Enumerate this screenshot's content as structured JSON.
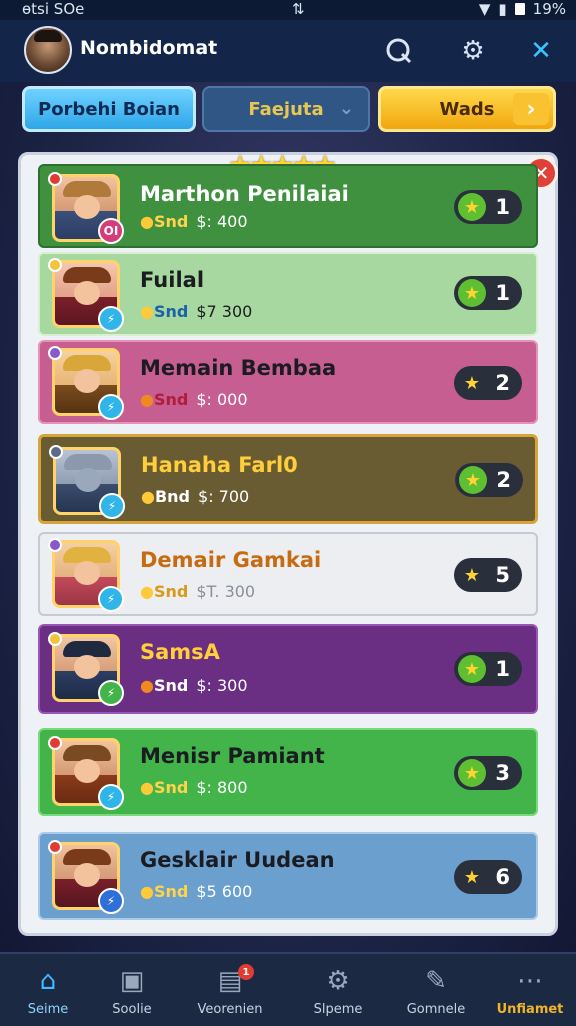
{
  "status_bar": {
    "carrier": "ɵtsi SOe",
    "center_icon": "sync-icon",
    "battery": "19%"
  },
  "header": {
    "username": "Nombidomat"
  },
  "tabs": [
    {
      "label": "Porbehi Boian"
    },
    {
      "label": "Faejuta"
    },
    {
      "label": "Wads"
    }
  ],
  "rows": [
    {
      "name": "Marthon Penilaiai",
      "label": "Snd",
      "price": "$: 400",
      "rank": "1",
      "badge": "OI"
    },
    {
      "name": "Fuilal",
      "label": "Snd",
      "price": "$7 300",
      "rank": "1",
      "badge": ""
    },
    {
      "name": "Memain Bembaa",
      "label": "Snd",
      "price": "$: 000",
      "rank": "2",
      "badge": ""
    },
    {
      "name": "Hanaha Farl0",
      "label": "Bnd",
      "price": "$: 700",
      "rank": "2",
      "badge": ""
    },
    {
      "name": "Demair Gamkai",
      "label": "Snd",
      "price": "$T. 300",
      "rank": "5",
      "badge": ""
    },
    {
      "name": "SamsA",
      "label": "Snd",
      "price": "$: 300",
      "rank": "1",
      "badge": ""
    },
    {
      "name": "Menisr Pamiant",
      "label": "Snd",
      "price": "$: 800",
      "rank": "3",
      "badge": ""
    },
    {
      "name": "Gesklair Uudean",
      "label": "Snd",
      "price": "$5 600",
      "rank": "6",
      "badge": ""
    }
  ],
  "nav": [
    {
      "label": "Seime",
      "icon": "home-icon"
    },
    {
      "label": "Soolie",
      "icon": "shop-icon"
    },
    {
      "label": "Veorenien",
      "icon": "chart-icon",
      "badge": "1"
    },
    {
      "label": "Slpeme",
      "icon": "gear-icon"
    },
    {
      "label": "Gomnele",
      "icon": "edit-icon"
    },
    {
      "label": "Unfiamet",
      "icon": "more-icon"
    }
  ]
}
